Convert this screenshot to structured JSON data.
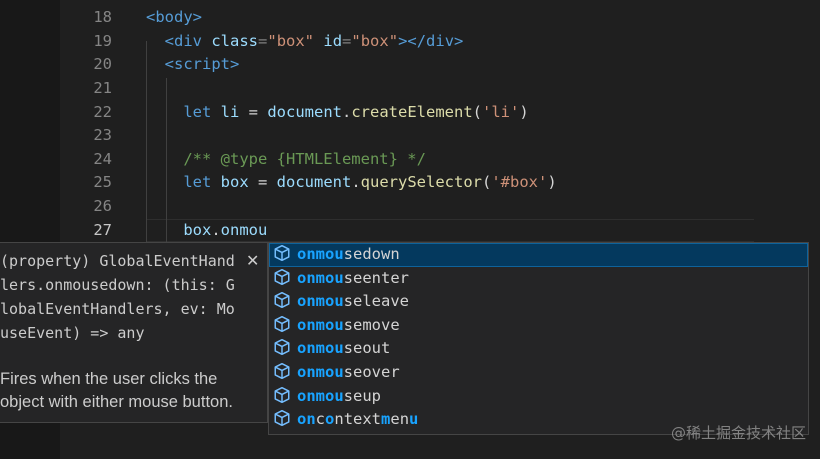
{
  "editor": {
    "lines": [
      {
        "num": "18",
        "tokens": [
          [
            "tag",
            "<body>"
          ]
        ]
      },
      {
        "num": "19",
        "tokens": [
          [
            "plain",
            "  "
          ],
          [
            "tag",
            "<div"
          ],
          [
            "plain",
            " "
          ],
          [
            "attr",
            "class"
          ],
          [
            "punct",
            "="
          ],
          [
            "str",
            "\"box\""
          ],
          [
            "plain",
            " "
          ],
          [
            "attr",
            "id"
          ],
          [
            "punct",
            "="
          ],
          [
            "str",
            "\"box\""
          ],
          [
            "tag",
            "></div>"
          ]
        ]
      },
      {
        "num": "20",
        "tokens": [
          [
            "plain",
            "  "
          ],
          [
            "tag",
            "<script>"
          ]
        ]
      },
      {
        "num": "21",
        "tokens": []
      },
      {
        "num": "22",
        "tokens": [
          [
            "plain",
            "    "
          ],
          [
            "kw",
            "let"
          ],
          [
            "plain",
            " "
          ],
          [
            "var",
            "li"
          ],
          [
            "plain",
            " = "
          ],
          [
            "var",
            "document"
          ],
          [
            "plain",
            "."
          ],
          [
            "fn",
            "createElement"
          ],
          [
            "plain",
            "("
          ],
          [
            "str",
            "'li'"
          ],
          [
            "plain",
            ")"
          ]
        ]
      },
      {
        "num": "23",
        "tokens": []
      },
      {
        "num": "24",
        "tokens": [
          [
            "plain",
            "    "
          ],
          [
            "comment",
            "/** @type {HTMLElement} */"
          ]
        ]
      },
      {
        "num": "25",
        "tokens": [
          [
            "plain",
            "    "
          ],
          [
            "kw",
            "let"
          ],
          [
            "plain",
            " "
          ],
          [
            "var",
            "box"
          ],
          [
            "plain",
            " = "
          ],
          [
            "var",
            "document"
          ],
          [
            "plain",
            "."
          ],
          [
            "fn",
            "querySelector"
          ],
          [
            "plain",
            "("
          ],
          [
            "str",
            "'#box'"
          ],
          [
            "plain",
            ")"
          ]
        ]
      },
      {
        "num": "26",
        "tokens": []
      },
      {
        "num": "27",
        "tokens": [
          [
            "plain",
            "    "
          ],
          [
            "var",
            "box"
          ],
          [
            "plain",
            "."
          ],
          [
            "var",
            "onmou"
          ]
        ],
        "active": true
      }
    ]
  },
  "hover": {
    "signature": "(property) GlobalEventHandlers.onmousedown: (this: GlobalEventHandlers, ev: MouseEvent) => any",
    "description": "Fires when the user clicks the object with either mouse button.",
    "close_glyph": "✕"
  },
  "suggestions": [
    {
      "parts": [
        [
          "hl",
          "onmou"
        ],
        [
          "n",
          "sedown"
        ]
      ],
      "selected": true
    },
    {
      "parts": [
        [
          "hl",
          "onmou"
        ],
        [
          "n",
          "seenter"
        ]
      ]
    },
    {
      "parts": [
        [
          "hl",
          "onmou"
        ],
        [
          "n",
          "seleave"
        ]
      ]
    },
    {
      "parts": [
        [
          "hl",
          "onmou"
        ],
        [
          "n",
          "semove"
        ]
      ]
    },
    {
      "parts": [
        [
          "hl",
          "onmou"
        ],
        [
          "n",
          "seout"
        ]
      ]
    },
    {
      "parts": [
        [
          "hl",
          "onmou"
        ],
        [
          "n",
          "seover"
        ]
      ]
    },
    {
      "parts": [
        [
          "hl",
          "onmou"
        ],
        [
          "n",
          "seup"
        ]
      ]
    },
    {
      "parts": [
        [
          "hl",
          "on"
        ],
        [
          "n",
          "c"
        ],
        [
          "hl",
          "o"
        ],
        [
          "n",
          "ntext"
        ],
        [
          "hl",
          "m"
        ],
        [
          "n",
          "en"
        ],
        [
          "hl",
          "u"
        ]
      ]
    }
  ],
  "suggestion_icon": "property-cube-icon",
  "watermark": "@稀土掘金技术社区",
  "colors": {
    "background": "#1f1f1f",
    "match_highlight": "#18a3ff",
    "selected_row": "#04395e"
  }
}
